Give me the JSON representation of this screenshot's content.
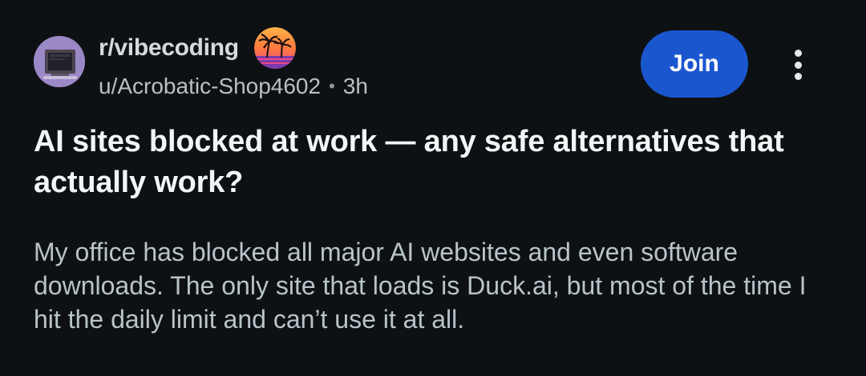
{
  "post": {
    "subreddit": "r/vibecoding",
    "author": "u/Acrobatic-Shop4602",
    "separator": "•",
    "age": "3h",
    "join_label": "Join",
    "title": "AI sites blocked at work — any safe alternatives that actually work?",
    "body": "My office has blocked all major AI websites and even software downloads. The only site that loads is Duck.ai, but most of the time I hit the daily limit and can’t use it at all."
  },
  "icons": {
    "avatar": "retro-computer-icon",
    "subreddit_icon": "palm-tree-sunset-icon",
    "more": "more-options-icon"
  },
  "colors": {
    "background": "#0e1113",
    "join_button": "#1a57cf",
    "avatar_bg": "#9b88c6",
    "sunset_orange": "#ff8a2a",
    "sunset_pink": "#e8478e"
  }
}
